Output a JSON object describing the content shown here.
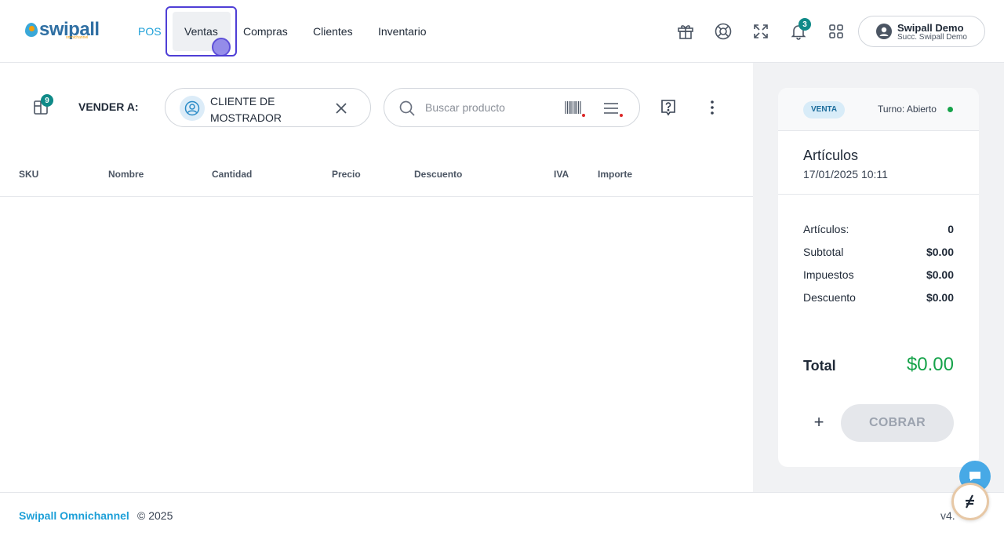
{
  "brand": {
    "logo_text": "swipall",
    "logo_sub": "omnichannel"
  },
  "nav": {
    "items": [
      {
        "label": "POS",
        "active": true
      },
      {
        "label": "Ventas",
        "focused": true
      },
      {
        "label": "Compras"
      },
      {
        "label": "Clientes"
      },
      {
        "label": "Inventario"
      }
    ]
  },
  "header_icons": {
    "gift": "gift-icon",
    "support": "lifebuoy-icon",
    "fullscreen": "expand-icon",
    "notifications": "bell-icon",
    "notifications_count": "3",
    "apps": "grid-icon"
  },
  "user": {
    "name": "Swipall Demo",
    "branch": "Succ. Swipall Demo"
  },
  "pos": {
    "cart_badge": "9",
    "sell_to_label": "VENDER A:",
    "client_name": "CLIENTE DE MOSTRADOR",
    "search_placeholder": "Buscar producto"
  },
  "table": {
    "columns": [
      "SKU",
      "Nombre",
      "Cantidad",
      "Precio",
      "Descuento",
      "IVA",
      "Importe"
    ],
    "rows": []
  },
  "summary": {
    "type_badge": "VENTA",
    "shift_status": "Turno: Abierto",
    "title": "Artículos",
    "date": "17/01/2025 10:11",
    "rows": [
      {
        "label": "Artículos:",
        "value": "0"
      },
      {
        "label": "Subtotal",
        "value": "$0.00"
      },
      {
        "label": "Impuestos",
        "value": "$0.00"
      },
      {
        "label": "Descuento",
        "value": "$0.00"
      }
    ],
    "total_label": "Total",
    "total_value": "$0.00",
    "plus_label": "+",
    "charge_label": "COBRAR"
  },
  "footer": {
    "brand": "Swipall Omnichannel",
    "copyright": "© 2025",
    "version": "v4."
  },
  "colors": {
    "accent": "#1ea0d8",
    "success": "#16a34a",
    "focus": "#4f3fd6",
    "badge": "#0f8a88"
  }
}
